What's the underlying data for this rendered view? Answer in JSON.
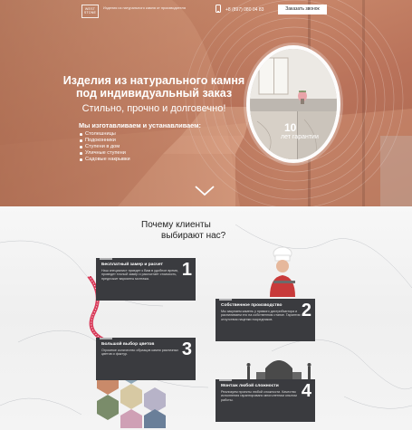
{
  "header": {
    "logo_text": "WEST STONE",
    "tagline": "Изделия из натурального камня от производителя",
    "phone": "+8 (897) 080 04 83",
    "call_button": "Заказать звонок",
    "phone_icon": "phone-icon"
  },
  "hero": {
    "title": "Изделия из натурального камня под индивидуальный заказ",
    "subtitle": "Стильно, прочно и долговечно!",
    "list_title": "Мы изготавливаем и устанавливаем:",
    "list": [
      "Столешницы",
      "Подоконники",
      "Ступени в дом",
      "Уличные ступени",
      "Садовые накрывки"
    ],
    "guarantee_number": "10",
    "guarantee_label": "лет гарантии",
    "scroll_icon": "chevron-down-icon"
  },
  "why": {
    "title_line1": "Почему клиенты",
    "title_line2": "выбирают нас?"
  },
  "cards": [
    {
      "number": "1",
      "title": "Бесплатный замер и расчет",
      "text": "Наш специалист приедет к Вам в удобное время, проведет точный замер и рассчитает стоимость, предложит варианты монтажа."
    },
    {
      "number": "2",
      "title": "Собственное производство",
      "text": "Мы закупаем камень у прямого дистрибьютора и распиливаем его на собственном станке. Гарантия отсутствия наценки посредников."
    },
    {
      "number": "3",
      "title": "Большой выбор цветов",
      "text": "Огромное количество образцов камня различных цветов и фактур."
    },
    {
      "number": "4",
      "title": "Монтаж любой сложности",
      "text": "Реализуем проекты любой сложности. Качество исполнения гарантировано многолетним опытом работы."
    }
  ],
  "colors": {
    "hero_accent": "#c8876a",
    "card_bg": "#3a3b3f"
  }
}
